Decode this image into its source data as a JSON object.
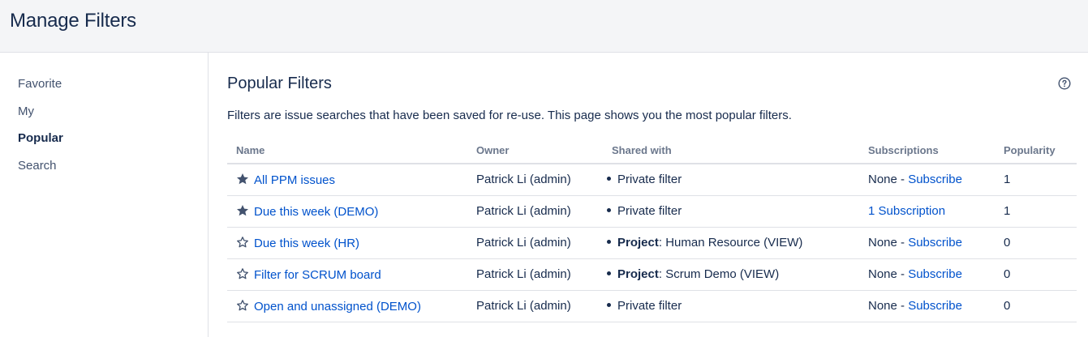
{
  "header": {
    "title": "Manage Filters"
  },
  "sidebar": {
    "items": [
      {
        "label": "Favorite",
        "active": false
      },
      {
        "label": "My",
        "active": false
      },
      {
        "label": "Popular",
        "active": true
      },
      {
        "label": "Search",
        "active": false
      }
    ]
  },
  "main": {
    "title": "Popular Filters",
    "help_icon": "help-circle-icon",
    "description": "Filters are issue searches that have been saved for re-use. This page shows you the most popular filters.",
    "columns": [
      "Name",
      "Owner",
      "Shared with",
      "Subscriptions",
      "Popularity"
    ],
    "rows": [
      {
        "favorite": true,
        "name": "All PPM issues",
        "owner": "Patrick Li (admin)",
        "shared_label": "",
        "shared_value": "Private filter",
        "subs_prefix": "None - ",
        "subs_link": "Subscribe",
        "popularity": "1"
      },
      {
        "favorite": true,
        "name": "Due this week (DEMO)",
        "owner": "Patrick Li (admin)",
        "shared_label": "",
        "shared_value": "Private filter",
        "subs_prefix": "",
        "subs_link": "1 Subscription",
        "popularity": "1"
      },
      {
        "favorite": false,
        "name": "Due this week (HR)",
        "owner": "Patrick Li (admin)",
        "shared_label": "Project",
        "shared_value": ": Human Resource (VIEW)",
        "subs_prefix": "None - ",
        "subs_link": "Subscribe",
        "popularity": "0"
      },
      {
        "favorite": false,
        "name": "Filter for SCRUM board",
        "owner": "Patrick Li (admin)",
        "shared_label": "Project",
        "shared_value": ": Scrum Demo (VIEW)",
        "subs_prefix": "None - ",
        "subs_link": "Subscribe",
        "popularity": "0"
      },
      {
        "favorite": false,
        "name": "Open and unassigned (DEMO)",
        "owner": "Patrick Li (admin)",
        "shared_label": "",
        "shared_value": "Private filter",
        "subs_prefix": "None - ",
        "subs_link": "Subscribe",
        "popularity": "0"
      }
    ]
  },
  "colors": {
    "link": "#0052cc",
    "text": "#172b4d",
    "header_bg": "#f4f5f7",
    "muted": "#6b778c"
  }
}
